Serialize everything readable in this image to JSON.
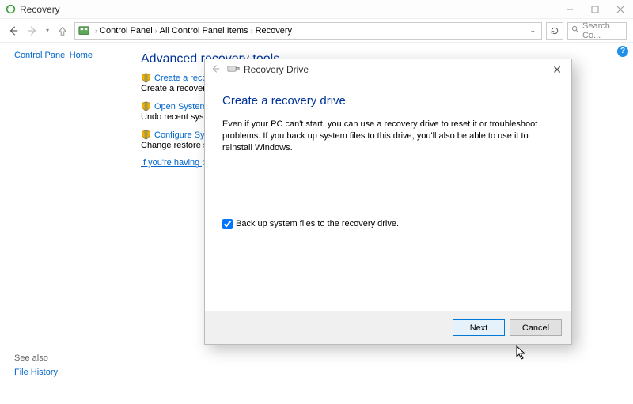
{
  "window": {
    "title": "Recovery",
    "min_label": "—",
    "max_label": "▢",
    "close_label": "✕"
  },
  "breadcrumb": {
    "items": [
      "Control Panel",
      "All Control Panel Items",
      "Recovery"
    ]
  },
  "search": {
    "placeholder": "Search Co..."
  },
  "sidebar": {
    "home": "Control Panel Home",
    "see_also_label": "See also",
    "see_also_link": "File History"
  },
  "content": {
    "heading": "Advanced recovery tools",
    "tools": [
      {
        "link": "Create a recovery drive",
        "desc_prefix": "Create a recovery drive to tro"
      },
      {
        "link": "Open System Restore",
        "desc_prefix": "Undo recent system changes,"
      },
      {
        "link": "Configure System Restore",
        "desc_prefix": "Change restore settings, man"
      }
    ],
    "trouble_link": "If you're having problems wit"
  },
  "dialog": {
    "wizard_title": "Recovery Drive",
    "heading": "Create a recovery drive",
    "body": "Even if your PC can't start, you can use a recovery drive to reset it or troubleshoot problems. If you back up system files to this drive, you'll also be able to use it to reinstall Windows.",
    "checkbox_label": "Back up system files to the recovery drive.",
    "checkbox_checked": true,
    "next_label": "Next",
    "cancel_label": "Cancel"
  }
}
